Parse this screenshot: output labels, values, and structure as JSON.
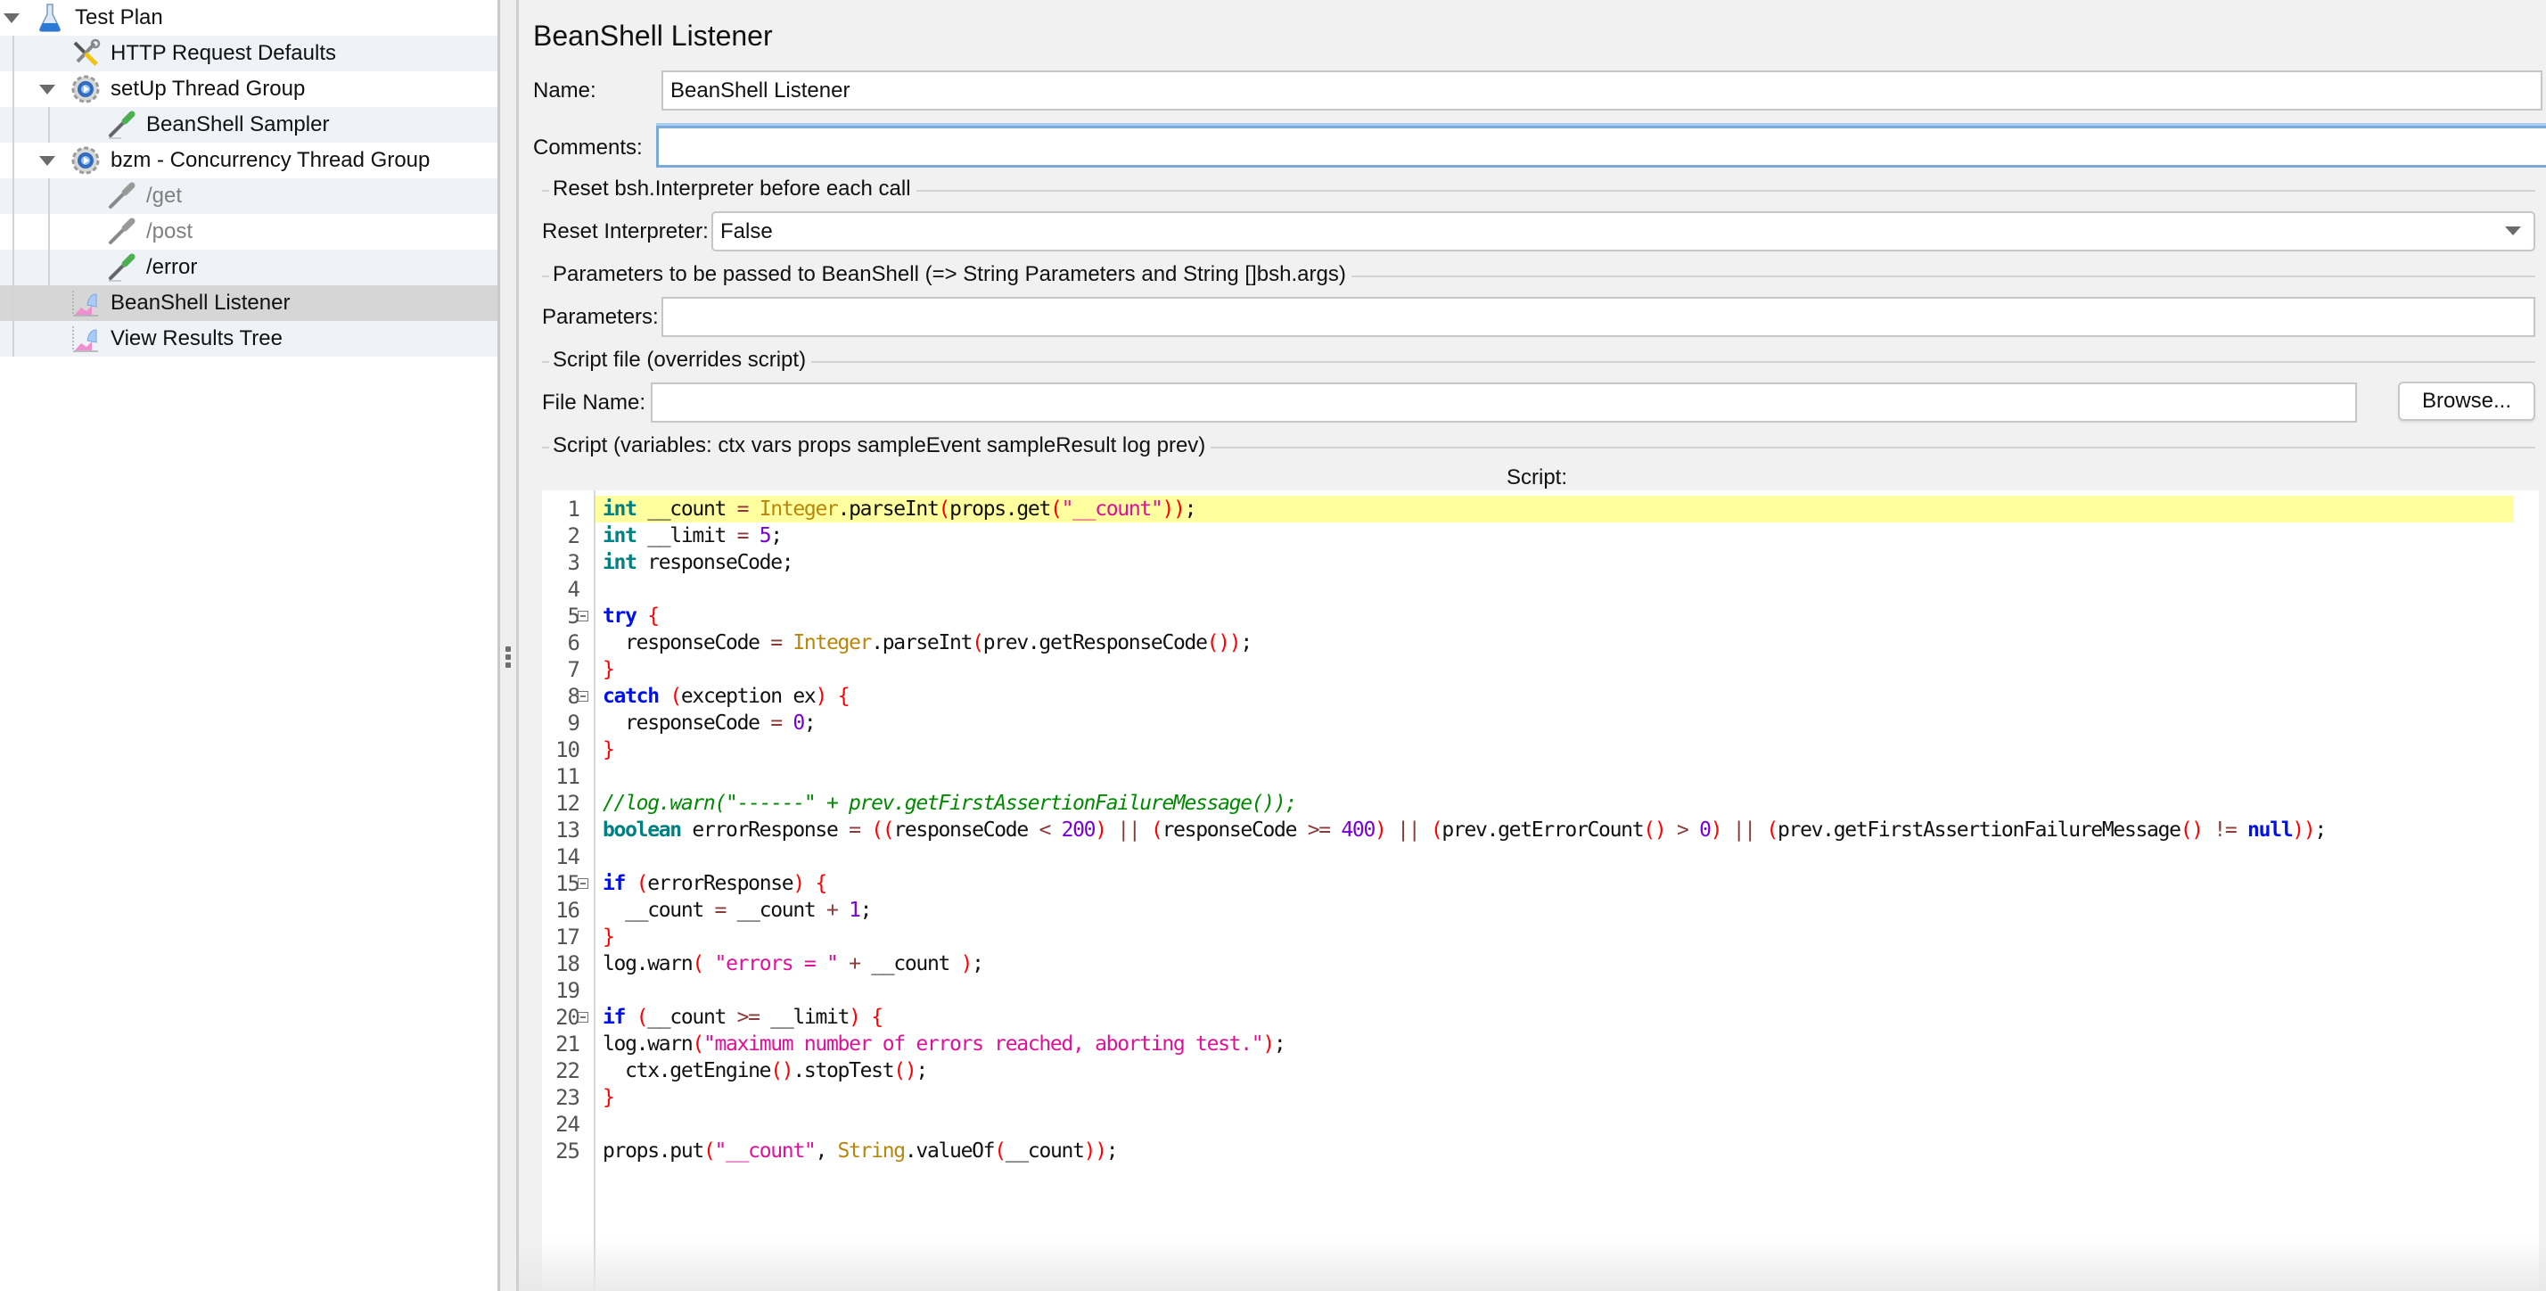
{
  "tree": {
    "items": [
      {
        "label": "Test Plan",
        "icon": "flask-icon",
        "level": 0,
        "expanded": true,
        "disabled": false,
        "selected": false
      },
      {
        "label": "HTTP Request Defaults",
        "icon": "tools-icon",
        "level": 1,
        "expanded": null,
        "disabled": false,
        "selected": false
      },
      {
        "label": "setUp Thread Group",
        "icon": "gear-icon",
        "level": 1,
        "expanded": true,
        "disabled": false,
        "selected": false
      },
      {
        "label": "BeanShell Sampler",
        "icon": "pipette-icon",
        "level": 2,
        "expanded": null,
        "disabled": false,
        "selected": false
      },
      {
        "label": "bzm - Concurrency Thread Group",
        "icon": "gear-icon",
        "level": 1,
        "expanded": true,
        "disabled": false,
        "selected": false
      },
      {
        "label": "/get",
        "icon": "pipette-disabled-icon",
        "level": 2,
        "expanded": null,
        "disabled": true,
        "selected": false
      },
      {
        "label": "/post",
        "icon": "pipette-disabled-icon",
        "level": 2,
        "expanded": null,
        "disabled": true,
        "selected": false
      },
      {
        "label": "/error",
        "icon": "pipette-icon",
        "level": 2,
        "expanded": null,
        "disabled": false,
        "selected": false
      },
      {
        "label": "BeanShell Listener",
        "icon": "listener-graph-icon",
        "level": 1,
        "expanded": null,
        "disabled": false,
        "selected": true
      },
      {
        "label": "View Results Tree",
        "icon": "listener-graph-icon",
        "level": 1,
        "expanded": null,
        "disabled": false,
        "selected": false
      }
    ]
  },
  "panel": {
    "title": "BeanShell Listener",
    "name_label": "Name:",
    "name_value": "BeanShell Listener",
    "comments_label": "Comments:",
    "comments_value": "",
    "reset_section": "Reset bsh.Interpreter before each call",
    "reset_label": "Reset Interpreter:",
    "reset_value": "False",
    "params_section": "Parameters to be passed to BeanShell (=> String Parameters and String []bsh.args)",
    "params_label": "Parameters:",
    "params_value": "",
    "file_section": "Script file (overrides script)",
    "file_label": "File Name:",
    "file_value": "",
    "browse_label": "Browse...",
    "script_section": "Script (variables: ctx vars props sampleEvent sampleResult log prev)",
    "script_label": "Script:"
  },
  "editor": {
    "current_line": 1,
    "fold_lines": [
      5,
      8,
      15,
      20
    ],
    "lines": [
      "int __count = Integer.parseInt(props.get(\"__count\"));",
      "int __limit = 5;",
      "int responseCode;",
      "",
      "try {",
      "  responseCode = Integer.parseInt(prev.getResponseCode());",
      "}",
      "catch (exception ex) {",
      "  responseCode = 0;",
      "}",
      "",
      "//log.warn(\"------\" + prev.getFirstAssertionFailureMessage());",
      "boolean errorResponse = ((responseCode < 200) || (responseCode >= 400) || (prev.getErrorCount() > 0) || (prev.getFirstAssertionFailureMessage() != null));",
      "",
      "if (errorResponse) {",
      "  __count = __count + 1;",
      "}",
      "log.warn( \"errors = \" + __count );",
      "",
      "if (__count >= __limit) {",
      "log.warn(\"maximum number of errors reached, aborting test.\");",
      "  ctx.getEngine().stopTest();",
      "}",
      "",
      "props.put(\"__count\", String.valueOf(__count));"
    ]
  },
  "colors": {
    "selection": "#d6d6d6",
    "alt_row": "#eff3f8",
    "focus_border": "#7aaad8",
    "current_line": "#ffff9f",
    "keyword": "#0010e8",
    "type": "#008080",
    "string": "#e0109a",
    "number": "#7a00d6",
    "comment": "#008a00"
  }
}
